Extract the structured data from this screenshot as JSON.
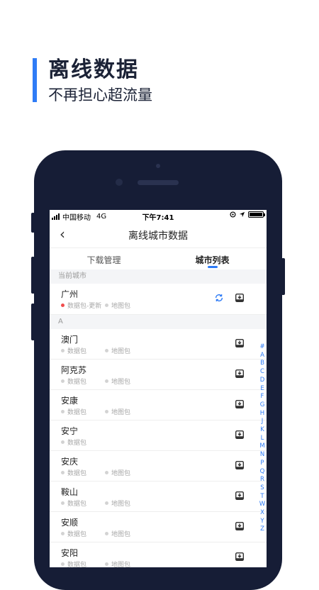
{
  "promo": {
    "title": "离线数据",
    "subtitle": "不再担心超流量",
    "accent": "#2f7cf6"
  },
  "status": {
    "carrier": "中国移动",
    "network": "4G",
    "time": "下午7:41"
  },
  "nav": {
    "title": "离线城市数据"
  },
  "tabs": [
    {
      "label": "下载管理",
      "active": false
    },
    {
      "label": "城市列表",
      "active": true
    }
  ],
  "current_section": "当前城市",
  "current_city": {
    "name": "广州",
    "data_tag": "数据包-更新",
    "map_tag": "地图包"
  },
  "section_a": "A",
  "cities": [
    {
      "name": "澳门",
      "data_tag": "数据包",
      "map_tag": "地图包"
    },
    {
      "name": "阿克苏",
      "data_tag": "数据包",
      "map_tag": "地图包"
    },
    {
      "name": "安康",
      "data_tag": "数据包",
      "map_tag": "地图包"
    },
    {
      "name": "安宁",
      "data_tag": "数据包",
      "map_tag": ""
    },
    {
      "name": "安庆",
      "data_tag": "数据包",
      "map_tag": "地图包"
    },
    {
      "name": "鞍山",
      "data_tag": "数据包",
      "map_tag": "地图包"
    },
    {
      "name": "安顺",
      "data_tag": "数据包",
      "map_tag": "地图包"
    },
    {
      "name": "安阳",
      "data_tag": "数据包",
      "map_tag": "地图包"
    }
  ],
  "alphabet": [
    "#",
    "A",
    "B",
    "C",
    "D",
    "E",
    "F",
    "G",
    "H",
    "J",
    "K",
    "L",
    "M",
    "N",
    "P",
    "Q",
    "R",
    "S",
    "T",
    "W",
    "X",
    "Y",
    "Z"
  ]
}
